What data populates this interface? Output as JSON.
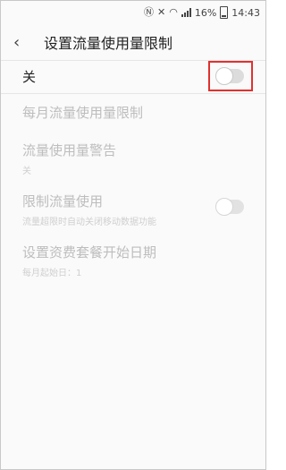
{
  "status": {
    "battery_text": "16%",
    "time": "14:43",
    "icons": [
      "nfc-icon",
      "mute-icon",
      "wifi-icon",
      "signal-icon",
      "battery-icon"
    ]
  },
  "header": {
    "title": "设置流量使用量限制"
  },
  "master": {
    "label": "关",
    "enabled": false
  },
  "items": [
    {
      "title": "每月流量使用量限制",
      "subtitle": ""
    },
    {
      "title": "流量使用量警告",
      "subtitle": "关"
    },
    {
      "title": "限制流量使用",
      "subtitle": "流量超限时自动关闭移动数据功能",
      "has_toggle": true,
      "toggle_on": false
    },
    {
      "title": "设置资费套餐开始日期",
      "subtitle": "每月起始日：1"
    }
  ],
  "colors": {
    "highlight_box": "#e0312f"
  }
}
